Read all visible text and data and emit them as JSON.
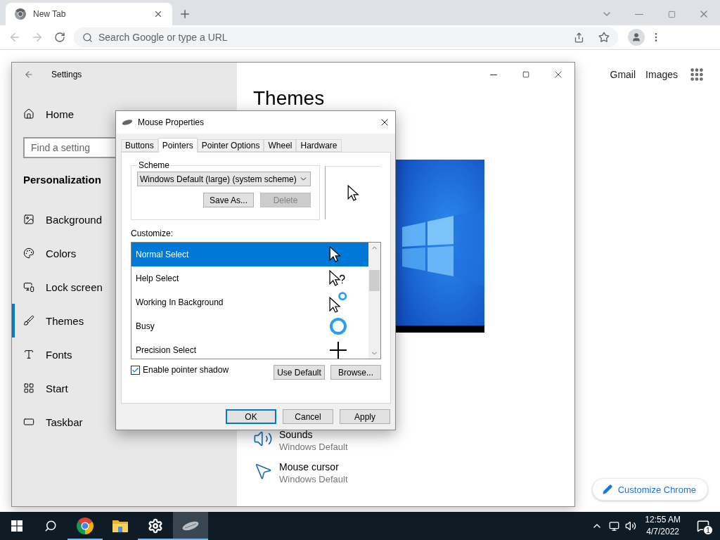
{
  "browser": {
    "tab_title": "New Tab",
    "omnibox_placeholder": "Search Google or type a URL",
    "links": [
      "Gmail",
      "Images"
    ],
    "customize_button": "Customize Chrome"
  },
  "settings": {
    "title": "Settings",
    "home": "Home",
    "search_placeholder": "Find a setting",
    "section": "Personalization",
    "nav": [
      {
        "kind": "background",
        "label": "Background",
        "selected": false
      },
      {
        "kind": "colors",
        "label": "Colors",
        "selected": false
      },
      {
        "kind": "lock",
        "label": "Lock screen",
        "selected": false
      },
      {
        "kind": "themes",
        "label": "Themes",
        "selected": true
      },
      {
        "kind": "fonts",
        "label": "Fonts",
        "selected": false
      },
      {
        "kind": "start",
        "label": "Start",
        "selected": false
      },
      {
        "kind": "taskbar",
        "label": "Taskbar",
        "selected": false
      }
    ],
    "heading": "Themes",
    "related": [
      {
        "kind": "sounds",
        "title": "Sounds",
        "subtitle": "Windows Default"
      },
      {
        "kind": "mouse",
        "title": "Mouse cursor",
        "subtitle": "Windows Default"
      }
    ]
  },
  "dialog": {
    "title": "Mouse Properties",
    "tabs": [
      {
        "label": "Buttons",
        "selected": false
      },
      {
        "label": "Pointers",
        "selected": true
      },
      {
        "label": "Pointer Options",
        "selected": false
      },
      {
        "label": "Wheel",
        "selected": false
      },
      {
        "label": "Hardware",
        "selected": false
      }
    ],
    "scheme": {
      "label": "Scheme",
      "value": "Windows Default (large) (system scheme)",
      "buttons": [
        {
          "label": "Save As...",
          "disabled": false
        },
        {
          "label": "Delete",
          "disabled": true
        }
      ]
    },
    "customize_label": "Customize:",
    "cursors": [
      {
        "kind": "arrow",
        "name": "Normal Select",
        "selected": true
      },
      {
        "kind": "help",
        "name": "Help Select",
        "selected": false
      },
      {
        "kind": "working",
        "name": "Working In Background",
        "selected": false
      },
      {
        "kind": "busy",
        "name": "Busy",
        "selected": false
      },
      {
        "kind": "precision",
        "name": "Precision Select",
        "selected": false
      }
    ],
    "shadow_checkbox": {
      "label": "Enable pointer shadow",
      "checked": true
    },
    "list_buttons": [
      "Use Default",
      "Browse..."
    ],
    "footer_buttons": [
      {
        "label": "OK",
        "default": true
      },
      {
        "label": "Cancel",
        "default": false
      },
      {
        "label": "Apply",
        "default": false
      }
    ]
  },
  "taskbar": {
    "apps": [
      {
        "kind": "chrome",
        "running": true,
        "selected": false
      },
      {
        "kind": "files",
        "running": false,
        "selected": false
      },
      {
        "kind": "settings",
        "running": true,
        "selected": false
      },
      {
        "kind": "mouse",
        "running": true,
        "selected": true
      }
    ],
    "time": "12:55 AM",
    "date": "4/7/2022",
    "notifications": "1"
  }
}
